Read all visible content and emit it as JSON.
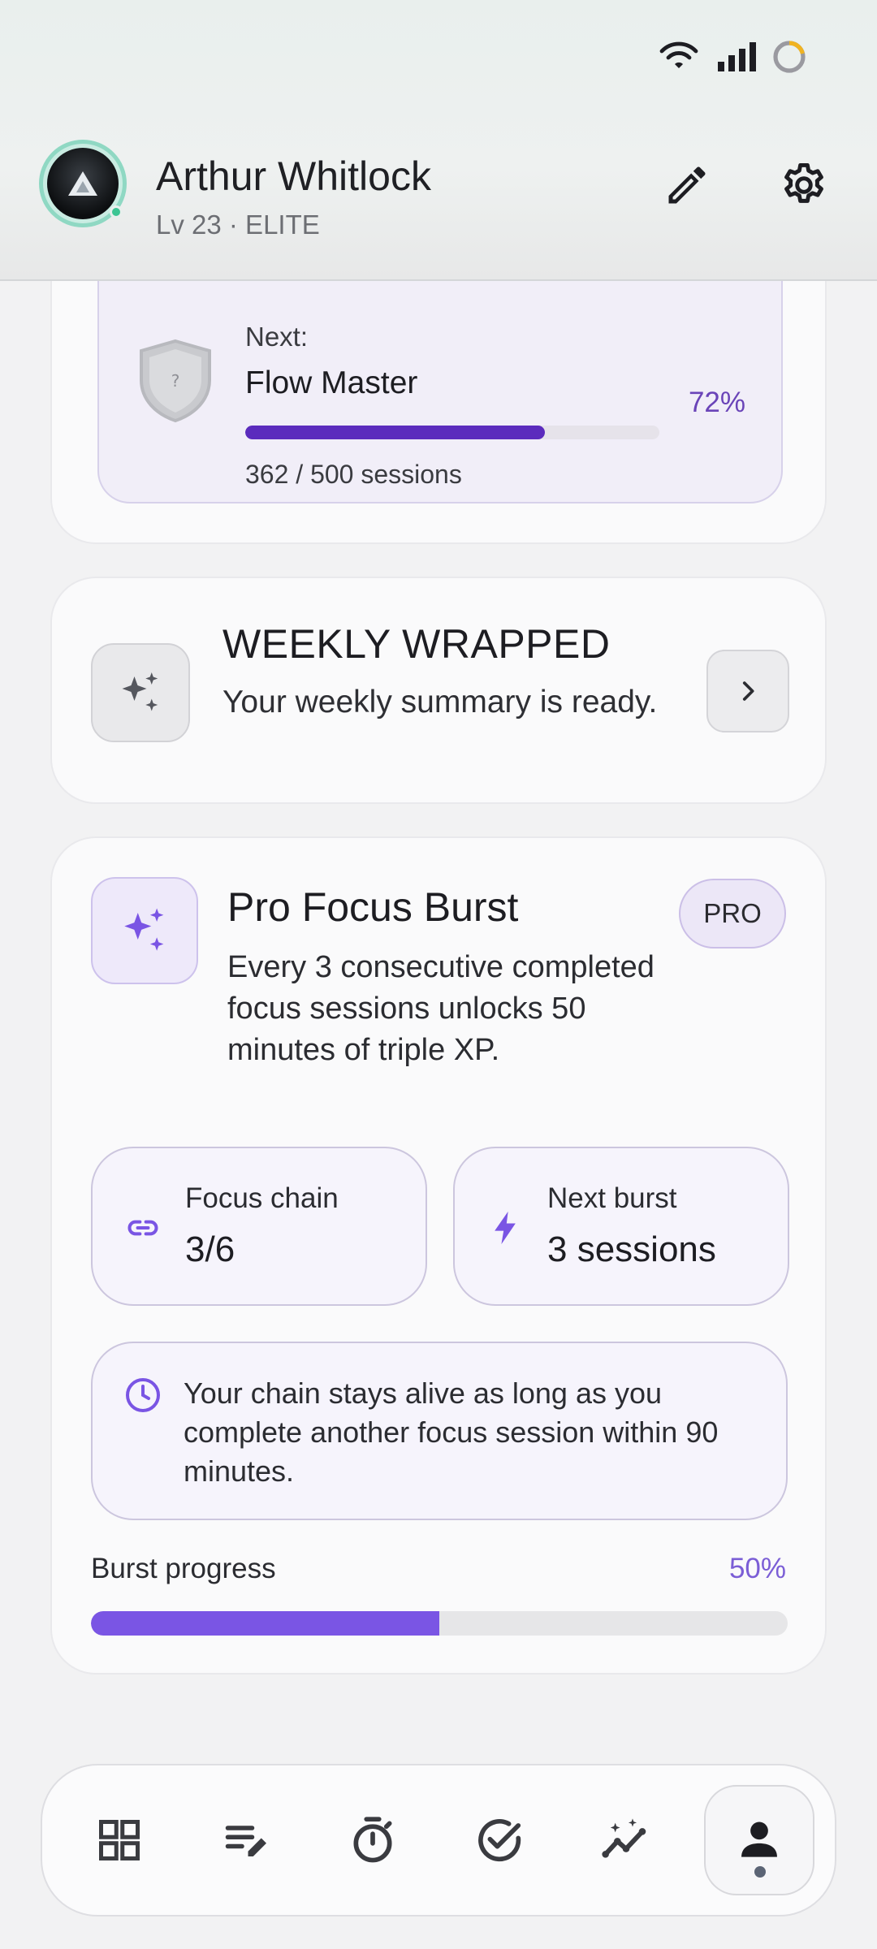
{
  "header": {
    "user_name": "Arthur Whitlock",
    "user_level": "Lv 23 · ELITE"
  },
  "next_achievement": {
    "label": "Next:",
    "title": "Flow Master",
    "percent_text": "72%",
    "progress": 0.724,
    "count_text": "362 / 500 sessions",
    "shield_glyph": "?"
  },
  "weekly": {
    "title": "WEEKLY WRAPPED",
    "subtitle": "Your weekly summary is ready."
  },
  "pro_burst": {
    "title": "Pro Focus Burst",
    "badge": "PRO",
    "description": "Every 3 consecutive completed focus sessions unlocks 50 minutes of triple XP.",
    "focus_chain_label": "Focus chain",
    "focus_chain_value": "3/6",
    "next_burst_label": "Next burst",
    "next_burst_value": "3 sessions",
    "info_text": "Your chain stays alive as long as you complete another focus session within 90 minutes.",
    "burst_progress_label": "Burst progress",
    "burst_progress_text": "50%",
    "burst_progress": 0.5
  },
  "colors": {
    "accent": "#7a55e4",
    "accent_dark": "#5b2bbd",
    "online": "#3cc593"
  },
  "nav": {
    "items": [
      "dashboard-icon",
      "notes-icon",
      "timer-icon",
      "check-circle-icon",
      "insights-icon",
      "profile-icon"
    ],
    "active_index": 5
  }
}
